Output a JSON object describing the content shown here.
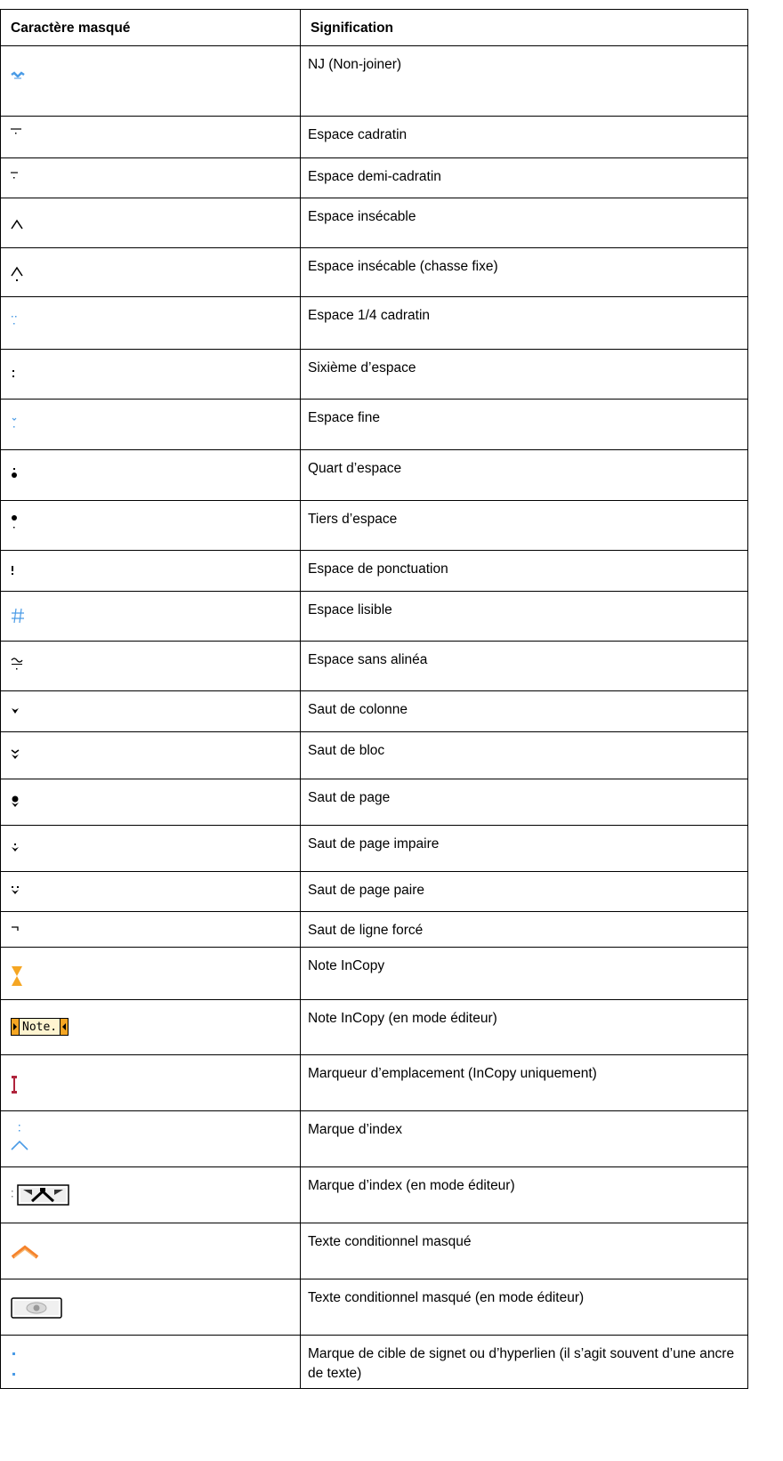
{
  "table": {
    "headers": [
      "Caractère masqué",
      "Signification"
    ],
    "rows": [
      {
        "icon": "non-joiner-icon",
        "meaning": "NJ (Non-joiner)"
      },
      {
        "icon": "em-space-icon",
        "meaning": "Espace cadratin"
      },
      {
        "icon": "en-space-icon",
        "meaning": "Espace demi-cadratin"
      },
      {
        "icon": "nonbreaking-space-icon",
        "meaning": "Espace insécable"
      },
      {
        "icon": "nonbreaking-space-fixed-width-icon",
        "meaning": "Espace insécable (chasse fixe)"
      },
      {
        "icon": "quarter-em-space-icon",
        "meaning": "Espace 1/4 cadratin"
      },
      {
        "icon": "sixth-space-icon",
        "meaning": "Sixième d’espace"
      },
      {
        "icon": "thin-space-icon",
        "meaning": "Espace fine"
      },
      {
        "icon": "quarter-space-icon",
        "meaning": "Quart d’espace"
      },
      {
        "icon": "third-space-icon",
        "meaning": "Tiers d’espace"
      },
      {
        "icon": "punctuation-space-icon",
        "meaning": "Espace de ponctuation"
      },
      {
        "icon": "figure-space-icon",
        "meaning": "Espace lisible"
      },
      {
        "icon": "flush-space-icon",
        "meaning": "Espace sans alinéa"
      },
      {
        "icon": "column-break-icon",
        "meaning": "Saut de colonne"
      },
      {
        "icon": "frame-break-icon",
        "meaning": "Saut de bloc"
      },
      {
        "icon": "page-break-icon",
        "meaning": "Saut de page"
      },
      {
        "icon": "odd-page-break-icon",
        "meaning": "Saut de page impaire"
      },
      {
        "icon": "even-page-break-icon",
        "meaning": "Saut de page paire"
      },
      {
        "icon": "forced-line-break-icon",
        "meaning": "Saut de ligne forcé"
      },
      {
        "icon": "incopy-note-icon",
        "meaning": "Note InCopy"
      },
      {
        "icon": "incopy-note-editor-icon",
        "meaning": "Note InCopy (en mode éditeur)",
        "label": "Note."
      },
      {
        "icon": "location-marker-icon",
        "meaning": "Marqueur d’emplacement (InCopy uniquement)"
      },
      {
        "icon": "index-marker-icon",
        "meaning": "Marque d’index"
      },
      {
        "icon": "index-marker-editor-icon",
        "meaning": "Marque d’index (en mode éditeur)"
      },
      {
        "icon": "hidden-conditional-text-icon",
        "meaning": "Texte conditionnel masqué"
      },
      {
        "icon": "hidden-conditional-text-editor-icon",
        "meaning": "Texte conditionnel masqué (en mode éditeur)"
      },
      {
        "icon": "bookmark-hyperlink-target-icon",
        "meaning": "Marque de cible de signet ou d’hyperlien (il s’agit souvent d’une ancre de texte)"
      }
    ]
  },
  "colors": {
    "blue": "#4a9be6",
    "orange": "#f5a623",
    "crimson": "#b0243c",
    "grey": "#808080"
  }
}
